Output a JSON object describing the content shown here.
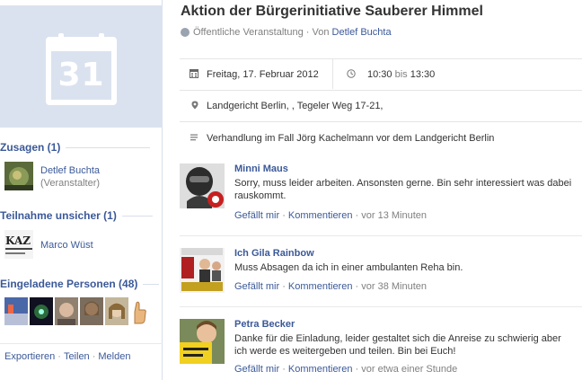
{
  "event": {
    "day": "31",
    "title": "Aktion der Bürgerinitiative Sauberer Himmel",
    "visibility": "Öffentliche Veranstaltung",
    "by_prefix": "· Von",
    "organizer": "Detlef Buchta",
    "date": "Freitag, 17. Februar 2012",
    "time_start": "10:30",
    "time_sep": "bis",
    "time_end": "13:30",
    "location": "Landgericht Berlin, , Tegeler Weg 17-21,",
    "description": "Verhandlung im Fall Jörg Kachelmann vor dem Landgericht Berlin"
  },
  "sidebar": {
    "going_header": "Zusagen (1)",
    "going_name": "Detlef Buchta",
    "going_role": "(Veranstalter)",
    "maybe_header": "Teilnahme unsicher (1)",
    "maybe_name": "Marco Wüst",
    "invited_header": "Eingeladene Personen (48)",
    "footer": {
      "export": "Exportieren",
      "share": "Teilen",
      "report": "Melden",
      "sep": "·"
    }
  },
  "actions": {
    "like": "Gefällt mir",
    "comment": "Kommentieren",
    "sep": "·"
  },
  "posts": [
    {
      "author": "Minni Maus",
      "text": "Sorry, muss leider arbeiten. Ansonsten gerne. Bin sehr interessiert was dabei rauskommt.",
      "time": "vor 13 Minuten"
    },
    {
      "author": "Ich Gila Rainbow",
      "text": "Muss Absagen da ich in einer ambulanten Reha bin.",
      "time": "vor 38 Minuten"
    },
    {
      "author": "Petra Becker",
      "text": "Danke für die Einladung, leider gestaltet sich die Anreise zu schwierig aber ich werde es weitergeben und teilen. Bin bei Euch!",
      "time": "vor etwa einer Stunde"
    }
  ],
  "colors": {
    "link": "#3b5998",
    "muted": "#808080",
    "pic_bg": "#dbe2ef"
  }
}
